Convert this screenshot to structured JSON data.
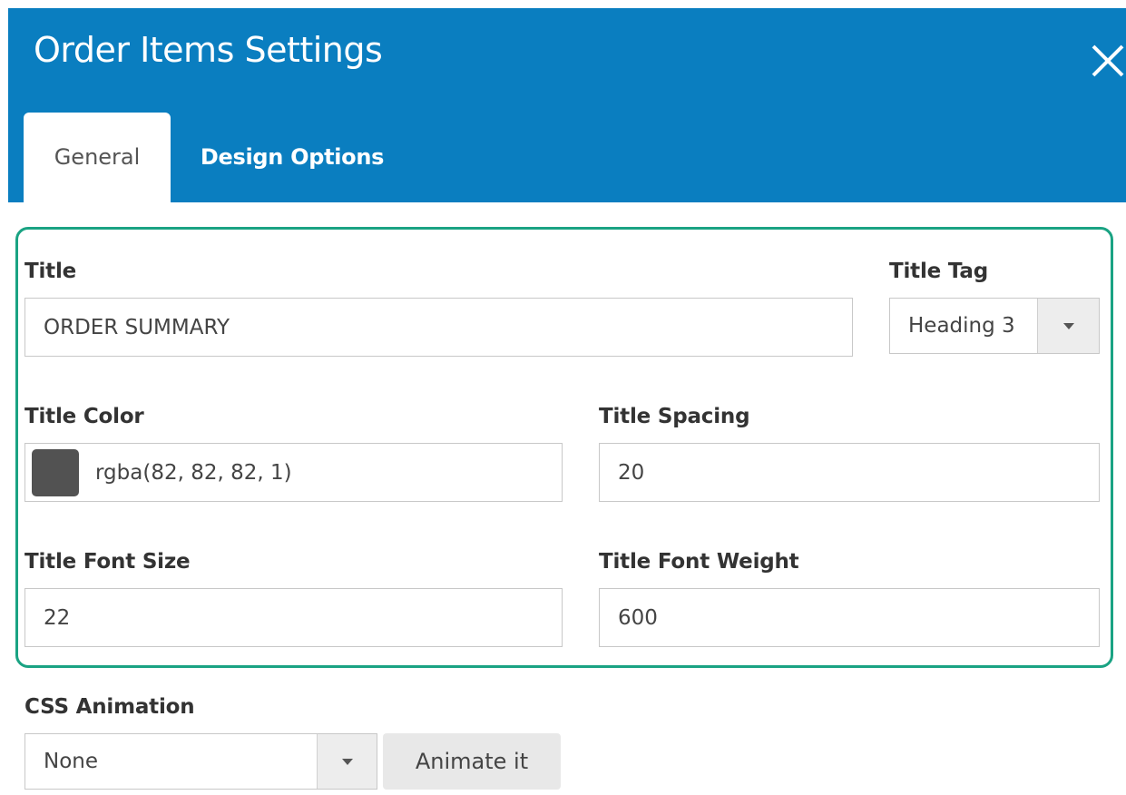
{
  "modal": {
    "title": "Order Items Settings",
    "close_icon": "close-icon"
  },
  "tabs": [
    {
      "label": "General",
      "active": true
    },
    {
      "label": "Design Options",
      "active": false
    }
  ],
  "fields": {
    "title": {
      "label": "Title",
      "value": "ORDER SUMMARY"
    },
    "title_tag": {
      "label": "Title Tag",
      "value": "Heading 3"
    },
    "title_color": {
      "label": "Title Color",
      "value": "rgba(82, 82, 82, 1)",
      "swatch": "#525252"
    },
    "title_spacing": {
      "label": "Title Spacing",
      "value": "20"
    },
    "title_font_size": {
      "label": "Title Font Size",
      "value": "22"
    },
    "title_font_weight": {
      "label": "Title Font Weight",
      "value": "600"
    },
    "css_animation": {
      "label": "CSS Animation",
      "value": "None",
      "button_label": "Animate it"
    }
  },
  "colors": {
    "header": "#0a7ec0",
    "highlight_border": "#1aa383"
  }
}
